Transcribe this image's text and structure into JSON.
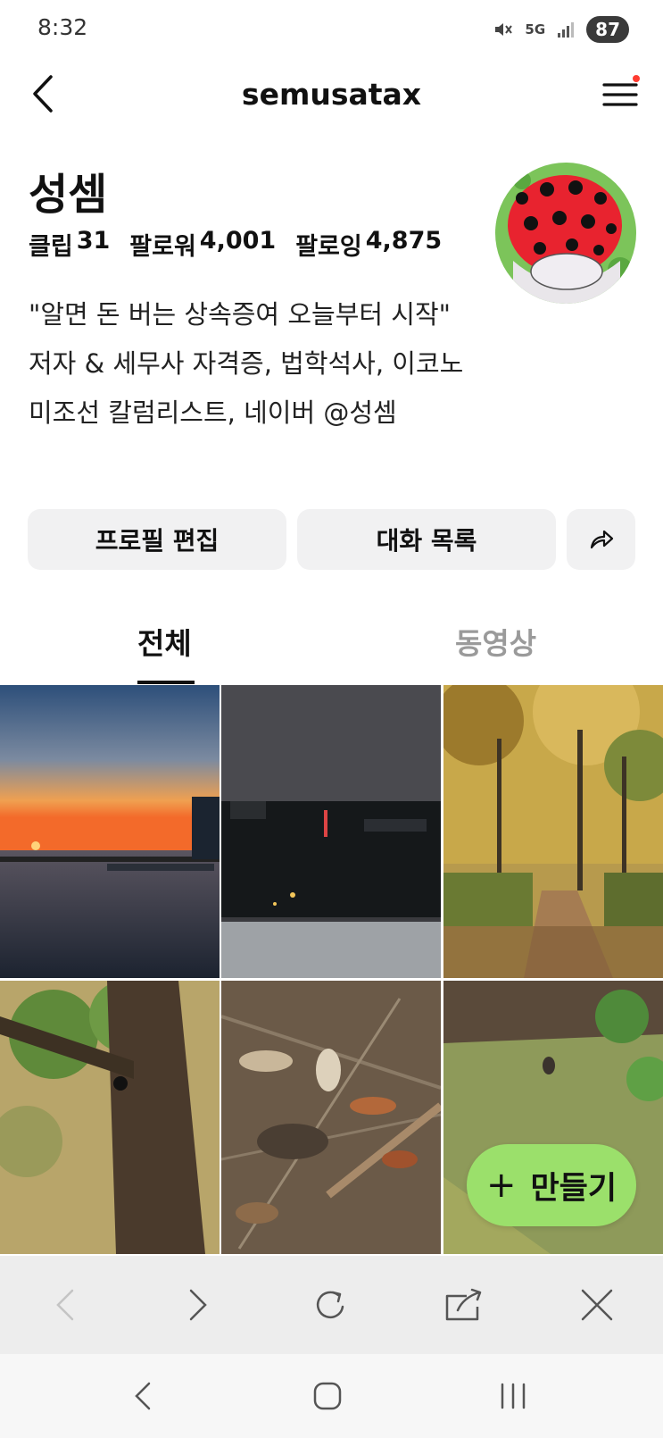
{
  "status": {
    "time": "8:32",
    "network": "5G",
    "battery": "87"
  },
  "header": {
    "title": "semusatax",
    "back_icon": "chevron-left-icon",
    "menu_icon": "hamburger-menu-icon",
    "notification_dot_color": "#ff3b30"
  },
  "profile": {
    "name": "성셈",
    "stats": [
      {
        "label": "클립",
        "value": "31"
      },
      {
        "label": "팔로워",
        "value": "4,001"
      },
      {
        "label": "팔로잉",
        "value": "4,875"
      }
    ],
    "bio": "\"알면 돈 버는 상속증여 오늘부터 시작\" 저자 & 세무사 자격증, 법학석사, 이코노미조선 칼럼리스트, 네이버 @성셈"
  },
  "actions": {
    "edit_label": "프로필 편집",
    "chat_label": "대화 목록",
    "share_icon": "share-icon"
  },
  "tabs": [
    {
      "label": "전체",
      "active": true
    },
    {
      "label": "동영상",
      "active": false
    }
  ],
  "grid": {
    "items": [
      {
        "kind": "sunset-harbor"
      },
      {
        "kind": "night-city"
      },
      {
        "kind": "autumn-park-path"
      },
      {
        "kind": "tree-trunk"
      },
      {
        "kind": "fallen-leaves"
      },
      {
        "kind": "grass-squirrel"
      }
    ]
  },
  "fab": {
    "label": "만들기",
    "color": "#9be06b"
  },
  "browser_toolbar": [
    "back-icon",
    "forward-icon",
    "reload-icon",
    "share-out-icon",
    "close-icon"
  ],
  "system_nav": [
    "back-icon",
    "home-icon",
    "recents-icon"
  ]
}
